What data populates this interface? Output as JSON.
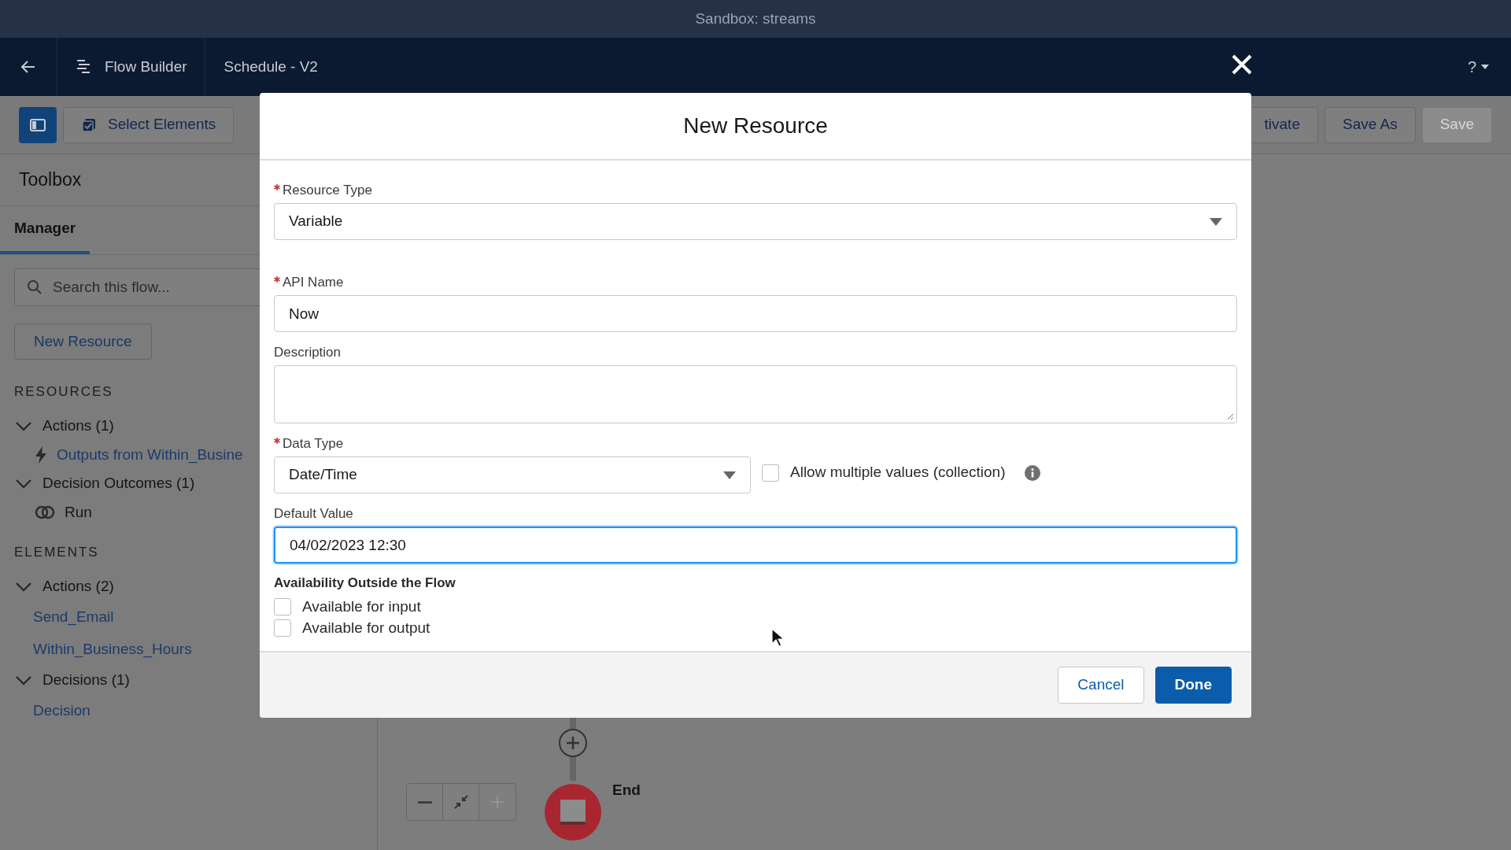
{
  "window": {
    "title": "Sandbox: streams"
  },
  "nav": {
    "app_name": "Flow Builder",
    "flow_name": "Schedule - V2",
    "help": "?"
  },
  "toolbar": {
    "select_elements": "Select Elements",
    "buttons": [
      {
        "label": "tivate",
        "disabled": false
      },
      {
        "label": "Save As",
        "disabled": false
      },
      {
        "label": "Save",
        "disabled": true
      }
    ]
  },
  "sidebar": {
    "title": "Toolbox",
    "tabs": [
      {
        "label": "Manager",
        "selected": true
      }
    ],
    "search": {
      "placeholder": "Search this flow..."
    },
    "new_resource": "New Resource",
    "sections": [
      {
        "heading": "RESOURCES",
        "groups": [
          {
            "label": "Actions (1)",
            "expanded": true,
            "children": [
              {
                "label": "Outputs from Within_Busine",
                "kind": "action"
              }
            ]
          },
          {
            "label": "Decision Outcomes (1)",
            "expanded": true,
            "children": [
              {
                "label": "Run",
                "kind": "outcome"
              }
            ]
          }
        ]
      },
      {
        "heading": "ELEMENTS",
        "groups": [
          {
            "label": "Actions (2)",
            "expanded": true,
            "children": [
              {
                "label": "Send_Email",
                "kind": "element"
              },
              {
                "label": "Within_Business_Hours",
                "kind": "element"
              }
            ]
          },
          {
            "label": "Decisions (1)",
            "expanded": true,
            "children": [
              {
                "label": "Decision",
                "kind": "element"
              }
            ]
          }
        ]
      }
    ]
  },
  "canvas": {
    "end_label": "End"
  },
  "modal": {
    "title": "New Resource",
    "fields": [
      {
        "kind": "select",
        "label": "Resource Type",
        "required": true,
        "value": "Variable"
      },
      {
        "kind": "text",
        "label": "API Name",
        "required": true,
        "value": "Now",
        "focused": false
      },
      {
        "kind": "textarea",
        "label": "Description",
        "required": false
      },
      {
        "kind": "select",
        "label": "Data Type",
        "required": true,
        "value": "Date/Time",
        "checkbox": {
          "label": "Allow multiple values (collection)",
          "checked": false
        }
      },
      {
        "kind": "text",
        "label": "Default Value",
        "required": false,
        "value": "04/02/2023 12:30",
        "focused": true
      }
    ],
    "availability": {
      "heading": "Availability Outside the Flow",
      "options": [
        {
          "label": "Available for input",
          "checked": false
        },
        {
          "label": "Available for output",
          "checked": false
        }
      ]
    },
    "buttons": [
      {
        "label": "Cancel",
        "kind": "neutral"
      },
      {
        "label": "Done",
        "kind": "brand"
      }
    ]
  }
}
